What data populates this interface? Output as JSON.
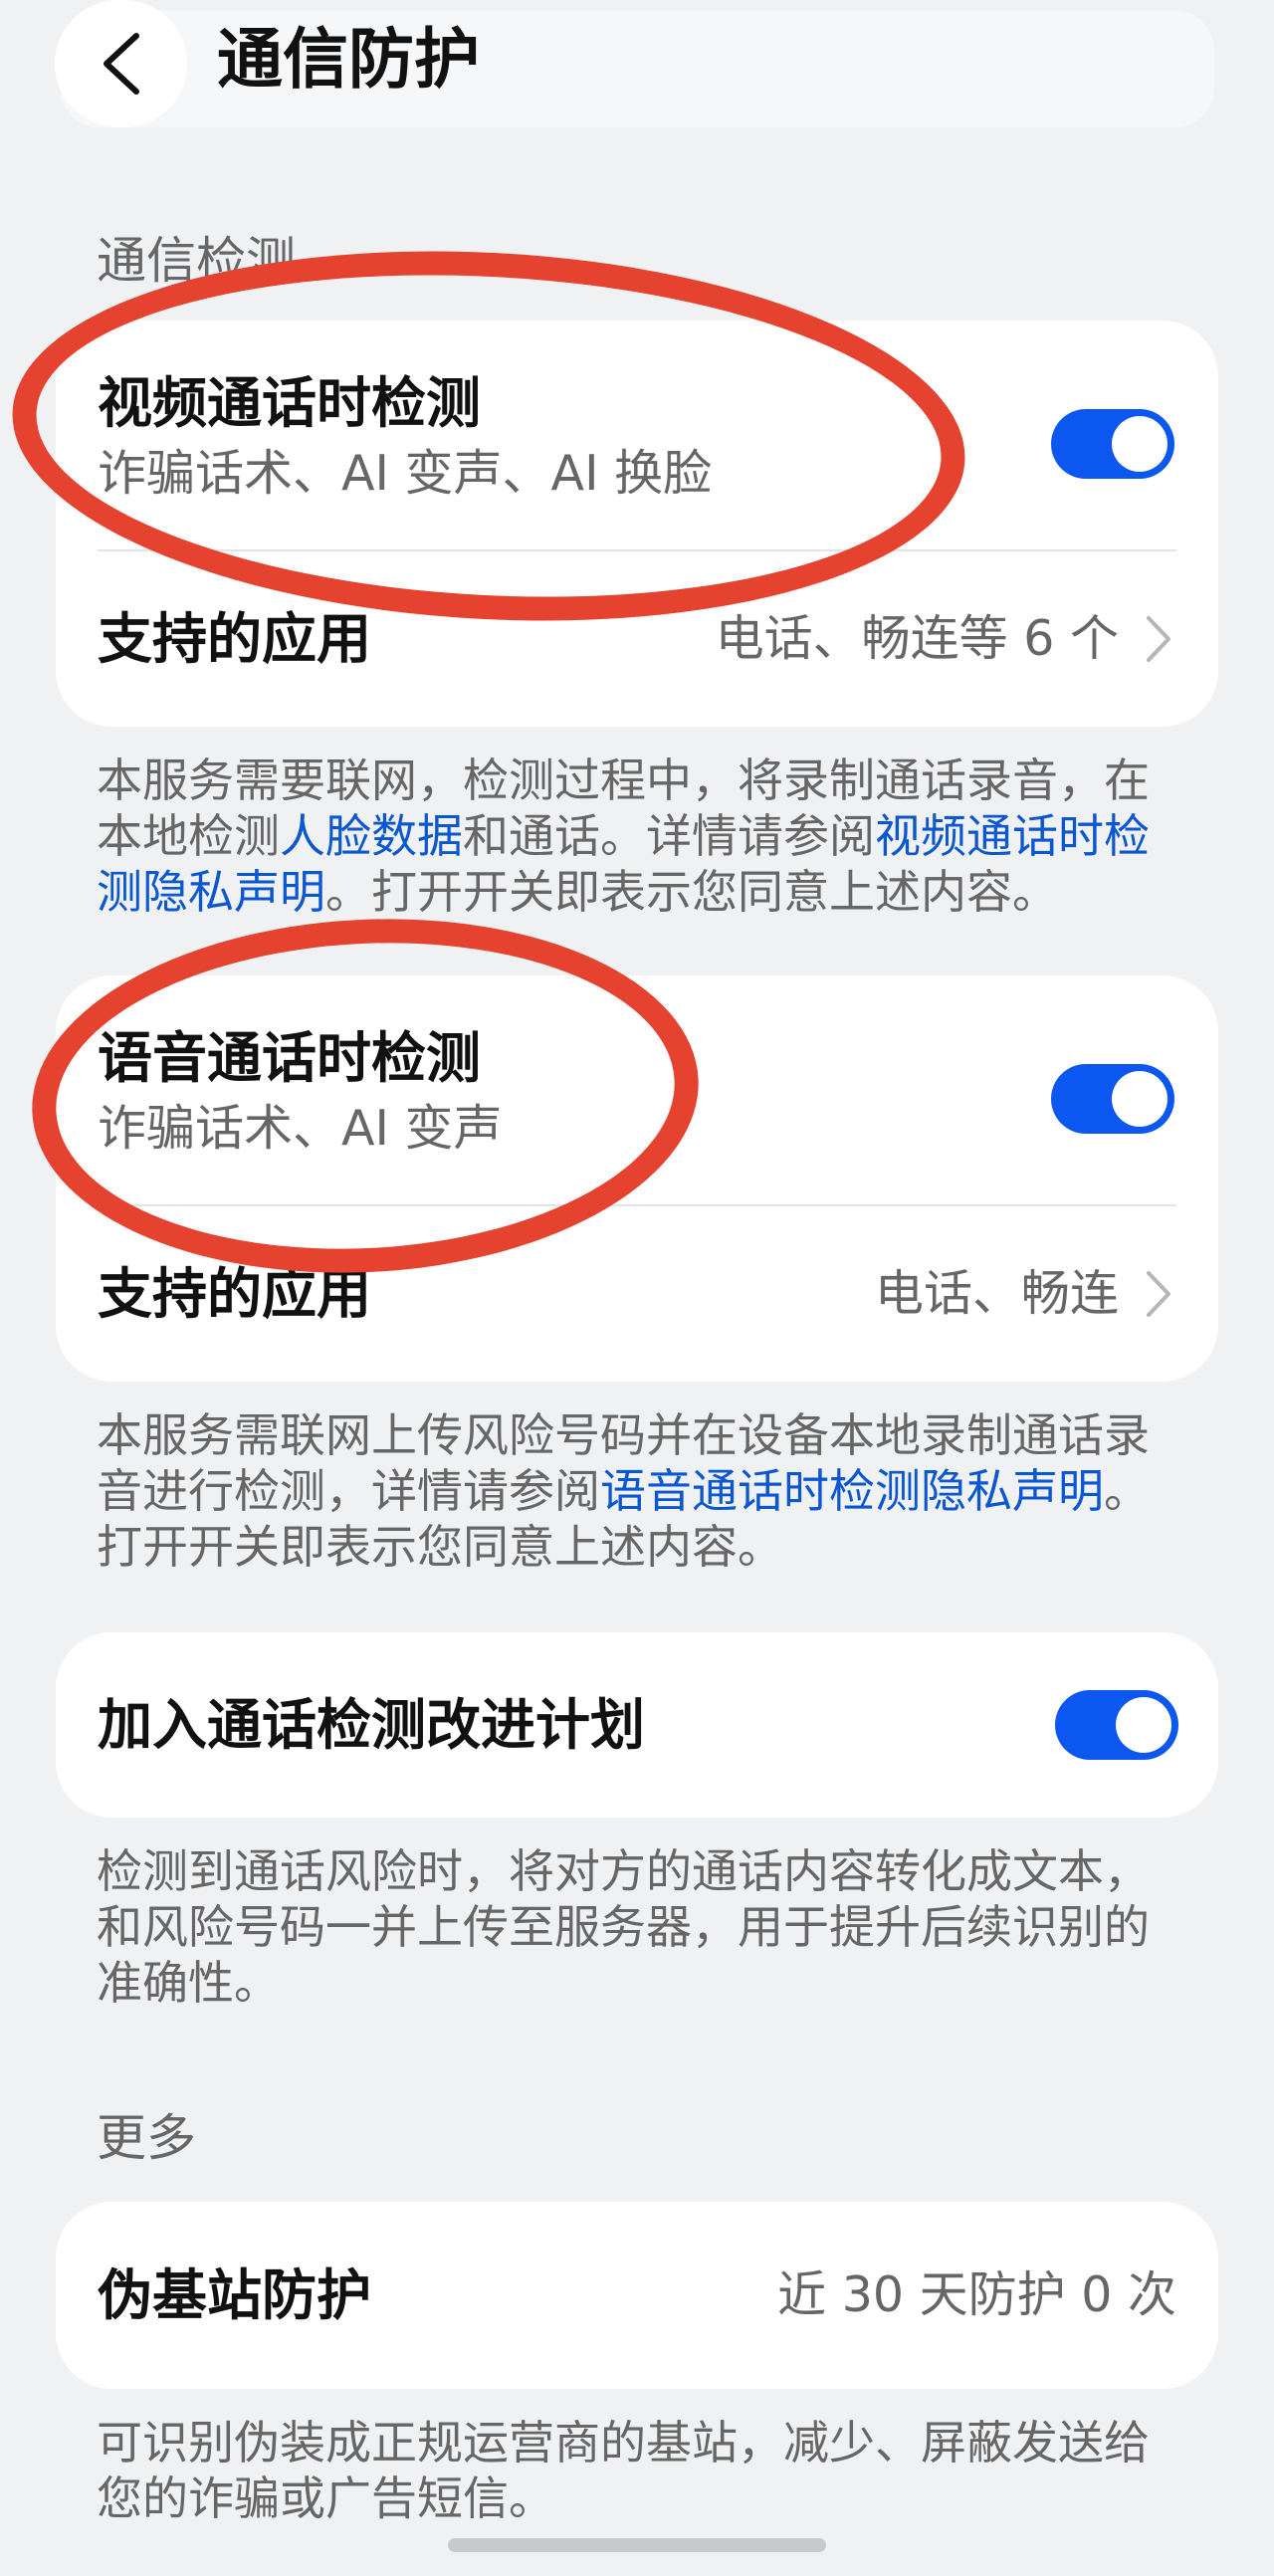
{
  "header": {
    "title": "通信防护",
    "back_icon": "chevron-left-icon"
  },
  "sections": {
    "detection": "通信检测",
    "more": "更多"
  },
  "video_card": {
    "title": "视频通话时检测",
    "subtitle": "诈骗话术、AI 变声、AI 换脸",
    "toggle_on": true,
    "apps_label": "支持的应用",
    "apps_value": "电话、畅连等 6 个"
  },
  "video_desc": {
    "p1": "本服务需要联网，检测过程中，将录制通话录音，在本地检测",
    "link1": "人脸数据",
    "p2": "和通话。详情请参阅",
    "link2": "视频通话时检测隐私声明",
    "p3": "。打开开关即表示您同意上述内容。"
  },
  "voice_card": {
    "title": "语音通话时检测",
    "subtitle": "诈骗话术、AI 变声",
    "toggle_on": true,
    "apps_label": "支持的应用",
    "apps_value": "电话、畅连"
  },
  "voice_desc": {
    "p1": "本服务需联网上传风险号码并在设备本地录制通话录音进行检测，详情请参阅",
    "link1": "语音通话时检测隐私声明",
    "p2": "。打开开关即表示您同意上述内容。"
  },
  "improve_card": {
    "title": "加入通话检测改进计划",
    "toggle_on": true
  },
  "improve_desc": "检测到通话风险时，将对方的通话内容转化成文本，和风险号码一并上传至服务器，用于提升后续识别的准确性。",
  "fake_station_card": {
    "title": "伪基站防护",
    "value": "近 30 天防护 0 次"
  },
  "fake_station_desc": "可识别伪装成正规运营商的基站，减少、屏蔽发送给您的诈骗或广告短信。",
  "colors": {
    "accent": "#0b57f0",
    "annotation": "#e5432f",
    "background": "#f0f1f3"
  }
}
